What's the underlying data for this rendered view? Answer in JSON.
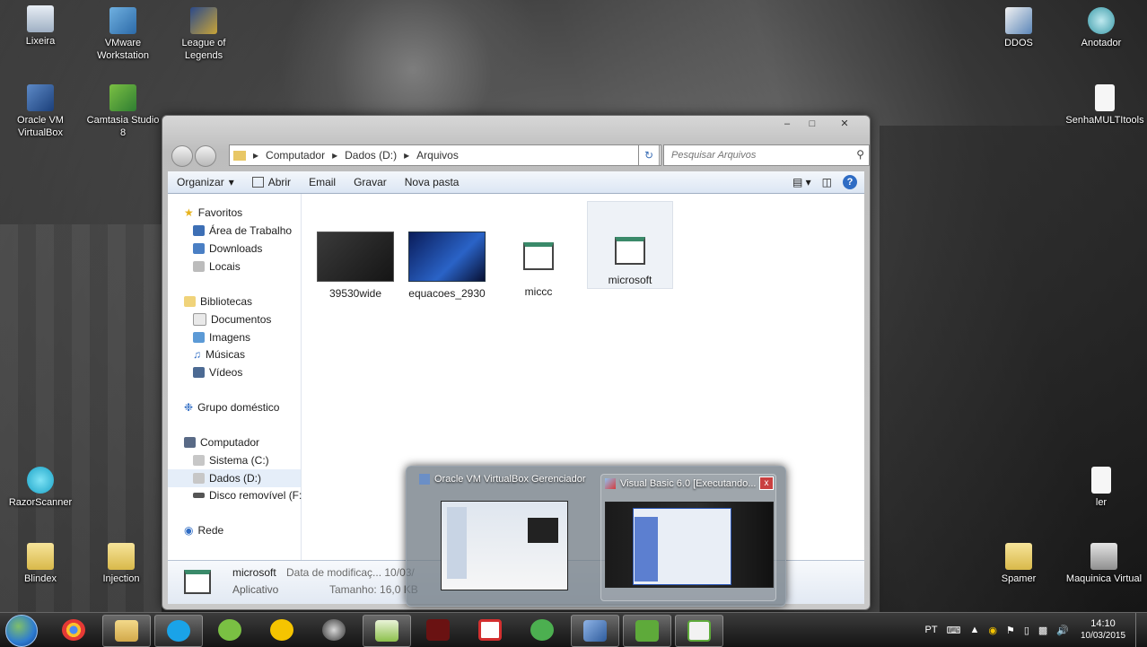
{
  "desktop": {
    "icons_left": [
      {
        "label": "Lixeira",
        "icon": "recycle-bin-icon"
      },
      {
        "label": "VMware Workstation",
        "icon": "vmware-icon"
      },
      {
        "label": "League of Legends",
        "icon": "league-icon"
      },
      {
        "label": "Oracle VM VirtualBox",
        "icon": "virtualbox-icon"
      },
      {
        "label": "Camtasia Studio 8",
        "icon": "camtasia-icon"
      },
      {
        "label": "RazorScanner",
        "icon": "razor-icon"
      },
      {
        "label": "Blindex",
        "icon": "folder-icon"
      },
      {
        "label": "Injection",
        "icon": "folder-icon"
      }
    ],
    "icons_right": [
      {
        "label": "DDOS",
        "icon": "python-icon"
      },
      {
        "label": "Anotador",
        "icon": "notepad-icon"
      },
      {
        "label": "SenhaMULTItools",
        "icon": "document-icon"
      },
      {
        "label": "ler",
        "icon": "document-icon"
      },
      {
        "label": "Spamer",
        "icon": "folder-icon"
      },
      {
        "label": "Maquinica Virtual",
        "icon": "vm-folder-icon"
      }
    ]
  },
  "explorer": {
    "window_controls": {
      "minimize": "–",
      "maximize": "□",
      "close": "✕"
    },
    "breadcrumb": [
      "Computador",
      "Dados (D:)",
      "Arquivos"
    ],
    "breadcrumb_sep": "▸",
    "search_placeholder": "Pesquisar Arquivos",
    "toolbar": {
      "organize": "Organizar",
      "open": "Abrir",
      "email": "Email",
      "burn": "Gravar",
      "new_folder": "Nova pasta"
    },
    "nav": {
      "favorites": "Favoritos",
      "desktop": "Área de Trabalho",
      "downloads": "Downloads",
      "places": "Locais",
      "libraries": "Bibliotecas",
      "documents": "Documentos",
      "images": "Imagens",
      "music": "Músicas",
      "videos": "Vídeos",
      "homegroup": "Grupo doméstico",
      "computer": "Computador",
      "system_c": "Sistema (C:)",
      "data_d": "Dados (D:)",
      "removable_f": "Disco removível (F:)",
      "network": "Rede"
    },
    "files": [
      {
        "name": "39530wide"
      },
      {
        "name": "equacoes_2930"
      },
      {
        "name": "miccc"
      },
      {
        "name": "microsoft"
      }
    ],
    "details": {
      "name": "microsoft",
      "type": "Aplicativo",
      "modified_label": "Data de modificaç...  10/03/",
      "size_label": "Tamanho:  16,0 KB"
    }
  },
  "taskbar_preview": {
    "items": [
      {
        "title": "Oracle VM VirtualBox Gerenciador"
      },
      {
        "title": "Visual Basic 6.0 [Executando..."
      }
    ],
    "close_glyph": "x"
  },
  "taskbar": {
    "apps": [
      "chrome",
      "explorer",
      "skype",
      "spotify",
      "tool",
      "globe",
      "notepad++",
      "game",
      "acrobat",
      "utorrent",
      "virtualbox",
      "camtasia",
      "camtasia-recorder"
    ],
    "language": "PT",
    "time": "14:10",
    "date": "10/03/2015"
  }
}
